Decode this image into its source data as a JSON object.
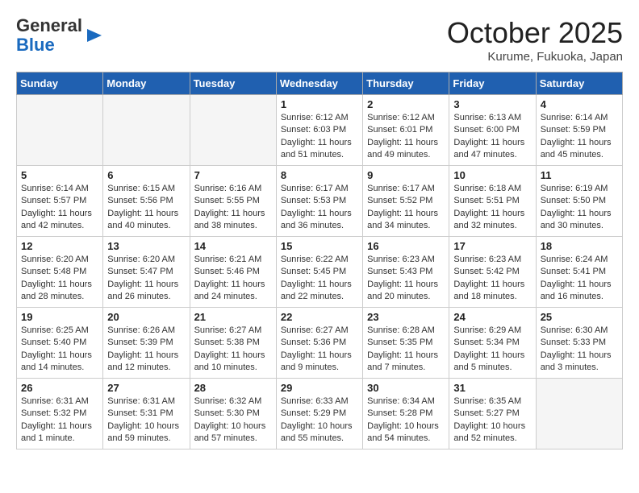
{
  "header": {
    "logo_general": "General",
    "logo_blue": "Blue",
    "month": "October 2025",
    "location": "Kurume, Fukuoka, Japan"
  },
  "weekdays": [
    "Sunday",
    "Monday",
    "Tuesday",
    "Wednesday",
    "Thursday",
    "Friday",
    "Saturday"
  ],
  "weeks": [
    [
      {
        "day": "",
        "text": "",
        "empty": true
      },
      {
        "day": "",
        "text": "",
        "empty": true
      },
      {
        "day": "",
        "text": "",
        "empty": true
      },
      {
        "day": "1",
        "text": "Sunrise: 6:12 AM\nSunset: 6:03 PM\nDaylight: 11 hours\nand 51 minutes.",
        "empty": false
      },
      {
        "day": "2",
        "text": "Sunrise: 6:12 AM\nSunset: 6:01 PM\nDaylight: 11 hours\nand 49 minutes.",
        "empty": false
      },
      {
        "day": "3",
        "text": "Sunrise: 6:13 AM\nSunset: 6:00 PM\nDaylight: 11 hours\nand 47 minutes.",
        "empty": false
      },
      {
        "day": "4",
        "text": "Sunrise: 6:14 AM\nSunset: 5:59 PM\nDaylight: 11 hours\nand 45 minutes.",
        "empty": false
      }
    ],
    [
      {
        "day": "5",
        "text": "Sunrise: 6:14 AM\nSunset: 5:57 PM\nDaylight: 11 hours\nand 42 minutes.",
        "empty": false
      },
      {
        "day": "6",
        "text": "Sunrise: 6:15 AM\nSunset: 5:56 PM\nDaylight: 11 hours\nand 40 minutes.",
        "empty": false
      },
      {
        "day": "7",
        "text": "Sunrise: 6:16 AM\nSunset: 5:55 PM\nDaylight: 11 hours\nand 38 minutes.",
        "empty": false
      },
      {
        "day": "8",
        "text": "Sunrise: 6:17 AM\nSunset: 5:53 PM\nDaylight: 11 hours\nand 36 minutes.",
        "empty": false
      },
      {
        "day": "9",
        "text": "Sunrise: 6:17 AM\nSunset: 5:52 PM\nDaylight: 11 hours\nand 34 minutes.",
        "empty": false
      },
      {
        "day": "10",
        "text": "Sunrise: 6:18 AM\nSunset: 5:51 PM\nDaylight: 11 hours\nand 32 minutes.",
        "empty": false
      },
      {
        "day": "11",
        "text": "Sunrise: 6:19 AM\nSunset: 5:50 PM\nDaylight: 11 hours\nand 30 minutes.",
        "empty": false
      }
    ],
    [
      {
        "day": "12",
        "text": "Sunrise: 6:20 AM\nSunset: 5:48 PM\nDaylight: 11 hours\nand 28 minutes.",
        "empty": false
      },
      {
        "day": "13",
        "text": "Sunrise: 6:20 AM\nSunset: 5:47 PM\nDaylight: 11 hours\nand 26 minutes.",
        "empty": false
      },
      {
        "day": "14",
        "text": "Sunrise: 6:21 AM\nSunset: 5:46 PM\nDaylight: 11 hours\nand 24 minutes.",
        "empty": false
      },
      {
        "day": "15",
        "text": "Sunrise: 6:22 AM\nSunset: 5:45 PM\nDaylight: 11 hours\nand 22 minutes.",
        "empty": false
      },
      {
        "day": "16",
        "text": "Sunrise: 6:23 AM\nSunset: 5:43 PM\nDaylight: 11 hours\nand 20 minutes.",
        "empty": false
      },
      {
        "day": "17",
        "text": "Sunrise: 6:23 AM\nSunset: 5:42 PM\nDaylight: 11 hours\nand 18 minutes.",
        "empty": false
      },
      {
        "day": "18",
        "text": "Sunrise: 6:24 AM\nSunset: 5:41 PM\nDaylight: 11 hours\nand 16 minutes.",
        "empty": false
      }
    ],
    [
      {
        "day": "19",
        "text": "Sunrise: 6:25 AM\nSunset: 5:40 PM\nDaylight: 11 hours\nand 14 minutes.",
        "empty": false
      },
      {
        "day": "20",
        "text": "Sunrise: 6:26 AM\nSunset: 5:39 PM\nDaylight: 11 hours\nand 12 minutes.",
        "empty": false
      },
      {
        "day": "21",
        "text": "Sunrise: 6:27 AM\nSunset: 5:38 PM\nDaylight: 11 hours\nand 10 minutes.",
        "empty": false
      },
      {
        "day": "22",
        "text": "Sunrise: 6:27 AM\nSunset: 5:36 PM\nDaylight: 11 hours\nand 9 minutes.",
        "empty": false
      },
      {
        "day": "23",
        "text": "Sunrise: 6:28 AM\nSunset: 5:35 PM\nDaylight: 11 hours\nand 7 minutes.",
        "empty": false
      },
      {
        "day": "24",
        "text": "Sunrise: 6:29 AM\nSunset: 5:34 PM\nDaylight: 11 hours\nand 5 minutes.",
        "empty": false
      },
      {
        "day": "25",
        "text": "Sunrise: 6:30 AM\nSunset: 5:33 PM\nDaylight: 11 hours\nand 3 minutes.",
        "empty": false
      }
    ],
    [
      {
        "day": "26",
        "text": "Sunrise: 6:31 AM\nSunset: 5:32 PM\nDaylight: 11 hours\nand 1 minute.",
        "empty": false
      },
      {
        "day": "27",
        "text": "Sunrise: 6:31 AM\nSunset: 5:31 PM\nDaylight: 10 hours\nand 59 minutes.",
        "empty": false
      },
      {
        "day": "28",
        "text": "Sunrise: 6:32 AM\nSunset: 5:30 PM\nDaylight: 10 hours\nand 57 minutes.",
        "empty": false
      },
      {
        "day": "29",
        "text": "Sunrise: 6:33 AM\nSunset: 5:29 PM\nDaylight: 10 hours\nand 55 minutes.",
        "empty": false
      },
      {
        "day": "30",
        "text": "Sunrise: 6:34 AM\nSunset: 5:28 PM\nDaylight: 10 hours\nand 54 minutes.",
        "empty": false
      },
      {
        "day": "31",
        "text": "Sunrise: 6:35 AM\nSunset: 5:27 PM\nDaylight: 10 hours\nand 52 minutes.",
        "empty": false
      },
      {
        "day": "",
        "text": "",
        "empty": true
      }
    ]
  ]
}
